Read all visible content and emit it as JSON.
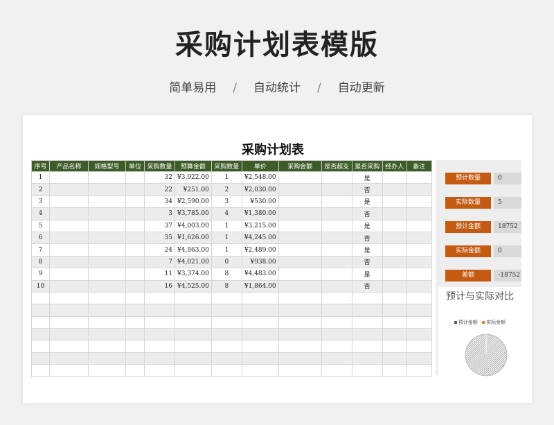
{
  "hero": {
    "title": "采购计划表模版",
    "subtitle": [
      "简单易用",
      "自动统计",
      "自动更新"
    ],
    "separator": "/"
  },
  "sheet": {
    "title": "采购计划表",
    "columns": [
      "序号",
      "产品名称",
      "规格型号",
      "单位",
      "采购数量",
      "预算金额",
      "采购数量",
      "单价",
      "采购金额",
      "是否超支",
      "是否采购",
      "经办人",
      "备注"
    ],
    "rows": [
      {
        "no": "1",
        "qty": "32",
        "budget": "¥3,922.00",
        "qty2": "1",
        "price": "¥2,548.00",
        "buy": "是"
      },
      {
        "no": "2",
        "qty": "22",
        "budget": "¥251.00",
        "qty2": "2",
        "price": "¥2,030.00",
        "buy": "否"
      },
      {
        "no": "3",
        "qty": "34",
        "budget": "¥2,590.00",
        "qty2": "3",
        "price": "¥530.00",
        "buy": "是"
      },
      {
        "no": "4",
        "qty": "3",
        "budget": "¥3,785.00",
        "qty2": "4",
        "price": "¥1,380.00",
        "buy": "否"
      },
      {
        "no": "5",
        "qty": "37",
        "budget": "¥4,003.00",
        "qty2": "1",
        "price": "¥3,215.00",
        "buy": "是"
      },
      {
        "no": "6",
        "qty": "35",
        "budget": "¥1,626.00",
        "qty2": "1",
        "price": "¥4,245.00",
        "buy": "否"
      },
      {
        "no": "7",
        "qty": "24",
        "budget": "¥4,863.00",
        "qty2": "1",
        "price": "¥2,489.00",
        "buy": "是"
      },
      {
        "no": "8",
        "qty": "7",
        "budget": "¥4,021.00",
        "qty2": "0",
        "price": "¥938.00",
        "buy": "否"
      },
      {
        "no": "9",
        "qty": "11",
        "budget": "¥3,374.00",
        "qty2": "8",
        "price": "¥4,483.00",
        "buy": "是"
      },
      {
        "no": "10",
        "qty": "16",
        "budget": "¥4,525.00",
        "qty2": "8",
        "price": "¥1,864.00",
        "buy": "否"
      }
    ],
    "empty_rows": 7
  },
  "stats": [
    {
      "label": "预计数量",
      "value": "0"
    },
    {
      "label": "实际数量",
      "value": "5"
    },
    {
      "label": "预计金额",
      "value": "18752"
    },
    {
      "label": "实际金额",
      "value": "0"
    },
    {
      "label": "差额",
      "value": "-18752"
    }
  ],
  "colors": {
    "header_green": "#3d5c27",
    "stat_orange": "#c55a11",
    "series_budget": "#595959",
    "series_actual": "#ed7d31"
  },
  "chart_data": {
    "type": "pie",
    "title": "预计与实际对比",
    "series": [
      {
        "name": "预计金额",
        "value": 18752
      },
      {
        "name": "实际金额",
        "value": 0
      }
    ],
    "legend": "top"
  }
}
